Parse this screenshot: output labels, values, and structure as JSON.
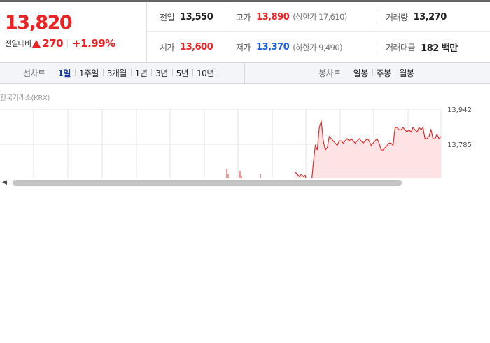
{
  "summary": {
    "current_price": "13,820",
    "change_label": "전일대비",
    "change_amount": "270",
    "change_rate": "+1.99%",
    "direction": "up"
  },
  "stats": {
    "prev_close_label": "전일",
    "prev_close": "13,550",
    "high_label": "고가",
    "high": "13,890",
    "upper_limit": "(상한가 17,610)",
    "volume_label": "거래량",
    "volume": "13,270",
    "open_label": "시가",
    "open": "13,600",
    "low_label": "저가",
    "low": "13,370",
    "lower_limit": "(하한가 9,490)",
    "trade_value_label": "거래대금",
    "trade_value": "182 백만"
  },
  "tabs": {
    "line_label": "선차트",
    "line_periods": [
      "1일",
      "1주일",
      "3개월",
      "1년",
      "3년",
      "5년",
      "10년"
    ],
    "line_active": 0,
    "candle_label": "봉차트",
    "candle_periods": [
      "일봉",
      "주봉",
      "월봉"
    ]
  },
  "source": "한국거래소(KRX)",
  "colors": {
    "up": "#ee2222",
    "down": "#1a5fd9",
    "line": "#e03030",
    "fill": "#fde3e3",
    "grid": "#e6e6e6"
  },
  "chart_data": {
    "type": "area",
    "x": [
      0,
      1,
      2,
      3,
      4,
      5,
      6,
      7,
      8,
      9,
      10,
      11,
      12,
      13,
      14,
      15,
      16,
      17,
      18,
      19,
      20,
      21,
      22,
      23,
      24,
      25,
      26,
      27,
      28,
      29,
      30,
      31,
      32,
      33,
      34,
      35,
      36,
      37,
      38,
      39,
      40,
      41,
      42,
      43,
      44,
      45,
      46,
      47,
      48,
      49,
      50,
      51,
      52,
      53,
      54,
      55,
      56,
      57,
      58,
      59,
      60,
      61,
      62,
      63,
      64,
      65,
      66,
      67,
      68,
      69,
      70,
      71,
      72,
      73
    ],
    "values": [
      13660,
      13650,
      13640,
      13650,
      13640,
      13645,
      13600,
      13590,
      13600,
      13700,
      13780,
      13760,
      13860,
      13890,
      13800,
      13760,
      13770,
      13820,
      13810,
      13800,
      13790,
      13780,
      13800,
      13800,
      13790,
      13800,
      13810,
      13800,
      13810,
      13800,
      13790,
      13800,
      13810,
      13800,
      13790,
      13800,
      13810,
      13800,
      13780,
      13790,
      13800,
      13810,
      13790,
      13760,
      13760,
      13770,
      13780,
      13790,
      13790,
      13780,
      13860,
      13860,
      13850,
      13850,
      13860,
      13850,
      13840,
      13850,
      13840,
      13860,
      13850,
      13840,
      13860,
      13850,
      13860,
      13810,
      13810,
      13820,
      13850,
      13810,
      13810,
      13830,
      13810,
      13820
    ],
    "y_ticks": [
      "13,942",
      "13,785"
    ],
    "ylim": [
      13600,
      13942
    ]
  }
}
